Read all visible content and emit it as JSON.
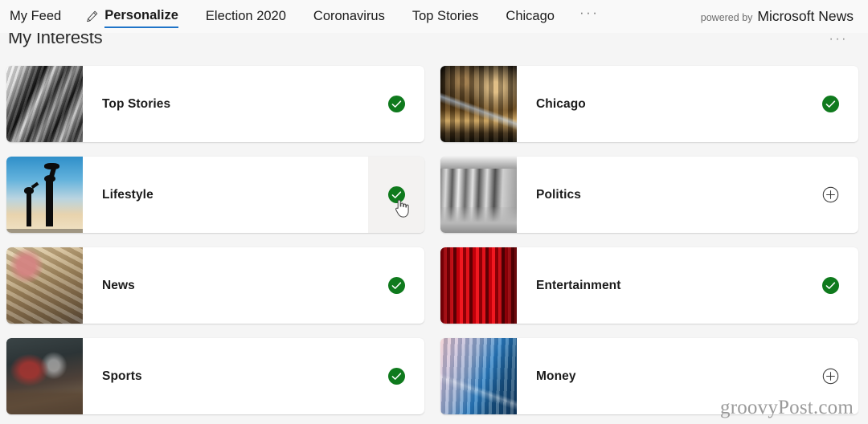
{
  "nav": {
    "items": [
      {
        "label": "My Feed",
        "active": false,
        "icon": null
      },
      {
        "label": "Personalize",
        "active": true,
        "icon": "pencil-icon"
      },
      {
        "label": "Election 2020",
        "active": false,
        "icon": null
      },
      {
        "label": "Coronavirus",
        "active": false,
        "icon": null
      },
      {
        "label": "Top Stories",
        "active": false,
        "icon": null
      },
      {
        "label": "Chicago",
        "active": false,
        "icon": null
      }
    ],
    "overflow_label": "···",
    "powered_by_prefix": "powered by",
    "powered_by_brand": "Microsoft News",
    "accent_color": "#1f74c8"
  },
  "section": {
    "title": "My Interests",
    "overflow_label": "···"
  },
  "colors": {
    "selected_green": "#0f7a1d",
    "page_background": "#f5f5f5",
    "card_background": "#ffffff",
    "hover_background": "#f3f2f1"
  },
  "interests": [
    {
      "label": "Top Stories",
      "state": "selected",
      "icon": "check-circle-icon",
      "thumb": "newspaper",
      "hovered": false
    },
    {
      "label": "Chicago",
      "state": "selected",
      "icon": "check-circle-icon",
      "thumb": "city-night",
      "hovered": false
    },
    {
      "label": "Lifestyle",
      "state": "selected",
      "icon": "check-circle-icon",
      "thumb": "family-silhouette",
      "hovered": true
    },
    {
      "label": "Politics",
      "state": "unselected",
      "icon": "plus-circle-icon",
      "thumb": "columns",
      "hovered": false
    },
    {
      "label": "News",
      "state": "selected",
      "icon": "check-circle-icon",
      "thumb": "newsprint",
      "hovered": false
    },
    {
      "label": "Entertainment",
      "state": "selected",
      "icon": "check-circle-icon",
      "thumb": "red-curtain",
      "hovered": false
    },
    {
      "label": "Sports",
      "state": "selected",
      "icon": "check-circle-icon",
      "thumb": "sports-gear",
      "hovered": false
    },
    {
      "label": "Money",
      "state": "unselected",
      "icon": "plus-circle-icon",
      "thumb": "coins",
      "hovered": false
    }
  ],
  "watermark": {
    "text": "groovyPost.com"
  },
  "cursor": {
    "type": "pointing-hand"
  }
}
